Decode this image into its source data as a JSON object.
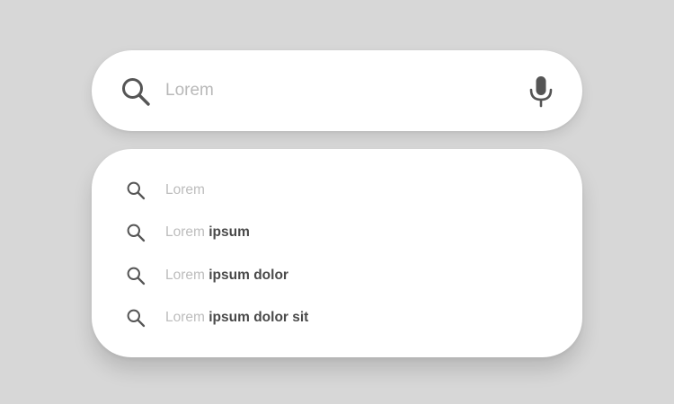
{
  "search": {
    "placeholder": "Lorem",
    "value": ""
  },
  "icons": {
    "search": "search-icon",
    "mic": "microphone-icon"
  },
  "suggestions": [
    {
      "typed": "Lorem",
      "completion": ""
    },
    {
      "typed": "Lorem",
      "completion": " ipsum"
    },
    {
      "typed": "Lorem",
      "completion": " ipsum dolor"
    },
    {
      "typed": "Lorem",
      "completion": " ipsum dolor sit"
    }
  ],
  "colors": {
    "background": "#d7d7d7",
    "card": "#ffffff",
    "icon": "#555555",
    "placeholder": "#b9b9b9",
    "suggestion_light": "#bdbdbd",
    "suggestion_bold": "#4a4a4a"
  }
}
